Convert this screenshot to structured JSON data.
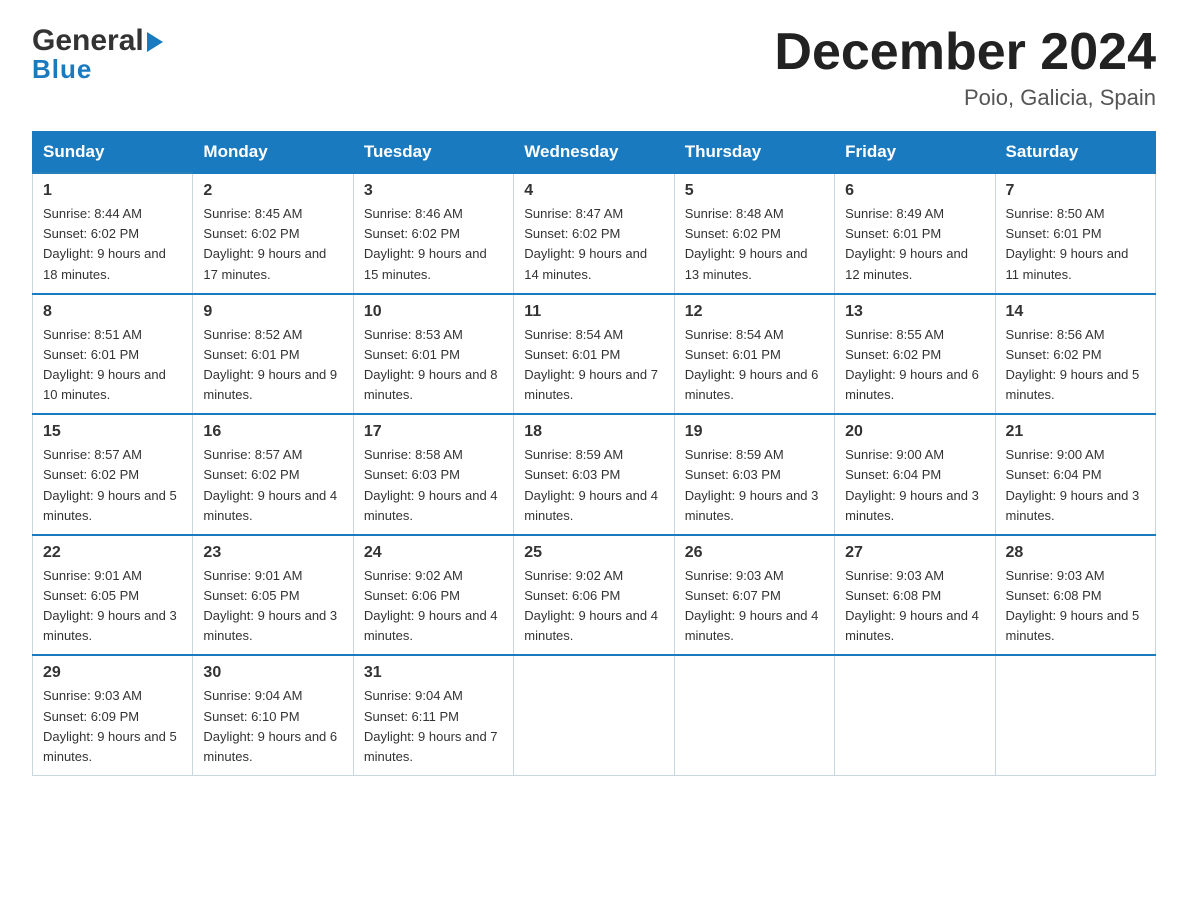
{
  "header": {
    "logo_top": "General",
    "logo_arrow": "▶",
    "logo_bottom": "Blue",
    "month_title": "December 2024",
    "subtitle": "Poio, Galicia, Spain"
  },
  "weekdays": [
    "Sunday",
    "Monday",
    "Tuesday",
    "Wednesday",
    "Thursday",
    "Friday",
    "Saturday"
  ],
  "weeks": [
    [
      {
        "day": "1",
        "sunrise": "8:44 AM",
        "sunset": "6:02 PM",
        "daylight": "9 hours and 18 minutes."
      },
      {
        "day": "2",
        "sunrise": "8:45 AM",
        "sunset": "6:02 PM",
        "daylight": "9 hours and 17 minutes."
      },
      {
        "day": "3",
        "sunrise": "8:46 AM",
        "sunset": "6:02 PM",
        "daylight": "9 hours and 15 minutes."
      },
      {
        "day": "4",
        "sunrise": "8:47 AM",
        "sunset": "6:02 PM",
        "daylight": "9 hours and 14 minutes."
      },
      {
        "day": "5",
        "sunrise": "8:48 AM",
        "sunset": "6:02 PM",
        "daylight": "9 hours and 13 minutes."
      },
      {
        "day": "6",
        "sunrise": "8:49 AM",
        "sunset": "6:01 PM",
        "daylight": "9 hours and 12 minutes."
      },
      {
        "day": "7",
        "sunrise": "8:50 AM",
        "sunset": "6:01 PM",
        "daylight": "9 hours and 11 minutes."
      }
    ],
    [
      {
        "day": "8",
        "sunrise": "8:51 AM",
        "sunset": "6:01 PM",
        "daylight": "9 hours and 10 minutes."
      },
      {
        "day": "9",
        "sunrise": "8:52 AM",
        "sunset": "6:01 PM",
        "daylight": "9 hours and 9 minutes."
      },
      {
        "day": "10",
        "sunrise": "8:53 AM",
        "sunset": "6:01 PM",
        "daylight": "9 hours and 8 minutes."
      },
      {
        "day": "11",
        "sunrise": "8:54 AM",
        "sunset": "6:01 PM",
        "daylight": "9 hours and 7 minutes."
      },
      {
        "day": "12",
        "sunrise": "8:54 AM",
        "sunset": "6:01 PM",
        "daylight": "9 hours and 6 minutes."
      },
      {
        "day": "13",
        "sunrise": "8:55 AM",
        "sunset": "6:02 PM",
        "daylight": "9 hours and 6 minutes."
      },
      {
        "day": "14",
        "sunrise": "8:56 AM",
        "sunset": "6:02 PM",
        "daylight": "9 hours and 5 minutes."
      }
    ],
    [
      {
        "day": "15",
        "sunrise": "8:57 AM",
        "sunset": "6:02 PM",
        "daylight": "9 hours and 5 minutes."
      },
      {
        "day": "16",
        "sunrise": "8:57 AM",
        "sunset": "6:02 PM",
        "daylight": "9 hours and 4 minutes."
      },
      {
        "day": "17",
        "sunrise": "8:58 AM",
        "sunset": "6:03 PM",
        "daylight": "9 hours and 4 minutes."
      },
      {
        "day": "18",
        "sunrise": "8:59 AM",
        "sunset": "6:03 PM",
        "daylight": "9 hours and 4 minutes."
      },
      {
        "day": "19",
        "sunrise": "8:59 AM",
        "sunset": "6:03 PM",
        "daylight": "9 hours and 3 minutes."
      },
      {
        "day": "20",
        "sunrise": "9:00 AM",
        "sunset": "6:04 PM",
        "daylight": "9 hours and 3 minutes."
      },
      {
        "day": "21",
        "sunrise": "9:00 AM",
        "sunset": "6:04 PM",
        "daylight": "9 hours and 3 minutes."
      }
    ],
    [
      {
        "day": "22",
        "sunrise": "9:01 AM",
        "sunset": "6:05 PM",
        "daylight": "9 hours and 3 minutes."
      },
      {
        "day": "23",
        "sunrise": "9:01 AM",
        "sunset": "6:05 PM",
        "daylight": "9 hours and 3 minutes."
      },
      {
        "day": "24",
        "sunrise": "9:02 AM",
        "sunset": "6:06 PM",
        "daylight": "9 hours and 4 minutes."
      },
      {
        "day": "25",
        "sunrise": "9:02 AM",
        "sunset": "6:06 PM",
        "daylight": "9 hours and 4 minutes."
      },
      {
        "day": "26",
        "sunrise": "9:03 AM",
        "sunset": "6:07 PM",
        "daylight": "9 hours and 4 minutes."
      },
      {
        "day": "27",
        "sunrise": "9:03 AM",
        "sunset": "6:08 PM",
        "daylight": "9 hours and 4 minutes."
      },
      {
        "day": "28",
        "sunrise": "9:03 AM",
        "sunset": "6:08 PM",
        "daylight": "9 hours and 5 minutes."
      }
    ],
    [
      {
        "day": "29",
        "sunrise": "9:03 AM",
        "sunset": "6:09 PM",
        "daylight": "9 hours and 5 minutes."
      },
      {
        "day": "30",
        "sunrise": "9:04 AM",
        "sunset": "6:10 PM",
        "daylight": "9 hours and 6 minutes."
      },
      {
        "day": "31",
        "sunrise": "9:04 AM",
        "sunset": "6:11 PM",
        "daylight": "9 hours and 7 minutes."
      },
      null,
      null,
      null,
      null
    ]
  ]
}
